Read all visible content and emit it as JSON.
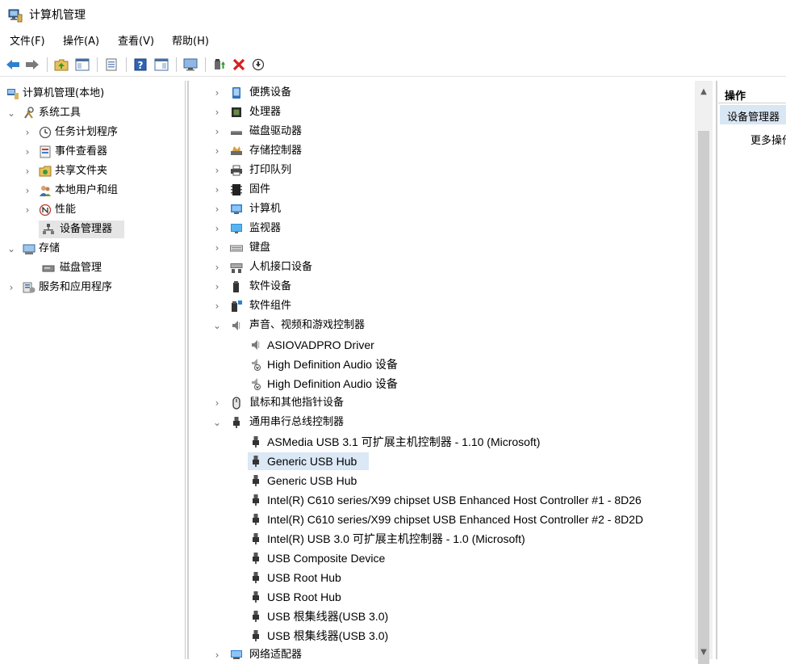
{
  "window": {
    "title": "计算机管理"
  },
  "menu": [
    {
      "label": "文件(F)"
    },
    {
      "label": "操作(A)"
    },
    {
      "label": "查看(V)"
    },
    {
      "label": "帮助(H)"
    }
  ],
  "tree": {
    "root": "计算机管理(本地)",
    "system_tools": "系统工具",
    "task_scheduler": "任务计划程序",
    "event_viewer": "事件查看器",
    "shared_folders": "共享文件夹",
    "local_users": "本地用户和组",
    "performance": "性能",
    "device_manager": "设备管理器",
    "storage": "存储",
    "disk_management": "磁盘管理",
    "services_apps": "服务和应用程序"
  },
  "devices": {
    "portable": "便携设备",
    "processors": "处理器",
    "disk_drives": "磁盘驱动器",
    "storage_controllers": "存储控制器",
    "print_queues": "打印队列",
    "firmware": "固件",
    "computer": "计算机",
    "monitors": "监视器",
    "keyboards": "键盘",
    "hid": "人机接口设备",
    "software_devices": "软件设备",
    "software_components": "软件组件",
    "sound": "声音、视频和游戏控制器",
    "sound_children": [
      "ASIOVADPRO Driver",
      "High Definition Audio 设备",
      "High Definition Audio 设备"
    ],
    "mice": "鼠标和其他指针设备",
    "usb": "通用串行总线控制器",
    "usb_children": [
      "ASMedia USB 3.1 可扩展主机控制器 - 1.10 (Microsoft)",
      "Generic USB Hub",
      "Generic USB Hub",
      "Intel(R) C610 series/X99 chipset USB Enhanced Host Controller #1 - 8D26",
      "Intel(R) C610 series/X99 chipset USB Enhanced Host Controller #2 - 8D2D",
      "Intel(R) USB 3.0 可扩展主机控制器 - 1.0 (Microsoft)",
      "USB Composite Device",
      "USB Root Hub",
      "USB Root Hub",
      "USB 根集线器(USB 3.0)",
      "USB 根集线器(USB 3.0)"
    ],
    "network": "网络适配器"
  },
  "actions": {
    "header": "操作",
    "selected": "设备管理器",
    "more": "更多操作"
  }
}
